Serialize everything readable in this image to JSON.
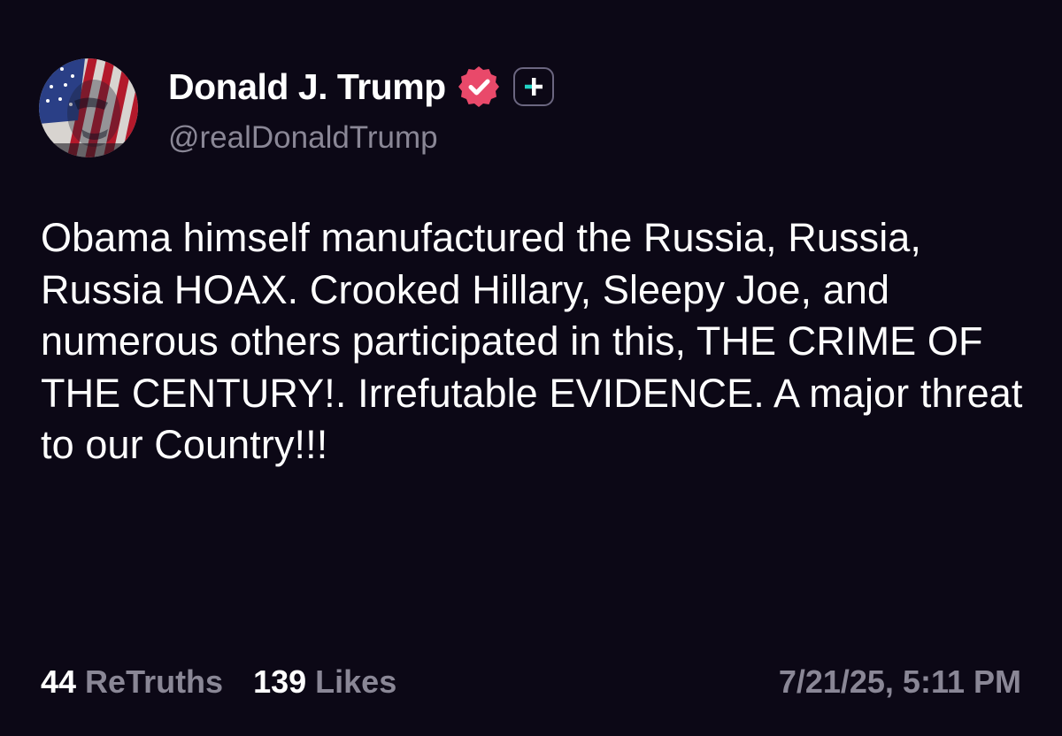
{
  "post": {
    "author": {
      "display_name": "Donald J. Trump",
      "handle": "@realDonaldTrump",
      "verified_icon": "verified-check-badge",
      "badge_icon": "plus-badge"
    },
    "body": "Obama himself manufactured the Russia, Russia, Russia HOAX. Crooked Hillary, Sleepy Joe, and numerous others participated in this, THE CRIME OF THE CENTURY!. Irrefutable EVIDENCE. A major threat to our Country!!!",
    "stats": {
      "retruths_count": "44",
      "retruths_label": "ReTruths",
      "likes_count": "139",
      "likes_label": "Likes"
    },
    "timestamp": "7/21/25, 5:11 PM"
  },
  "colors": {
    "background": "#0c0816",
    "text_primary": "#ffffff",
    "text_secondary": "#8a8796",
    "verified_badge": "#e9496a",
    "plus_badge_accent": "#22d3c5"
  }
}
